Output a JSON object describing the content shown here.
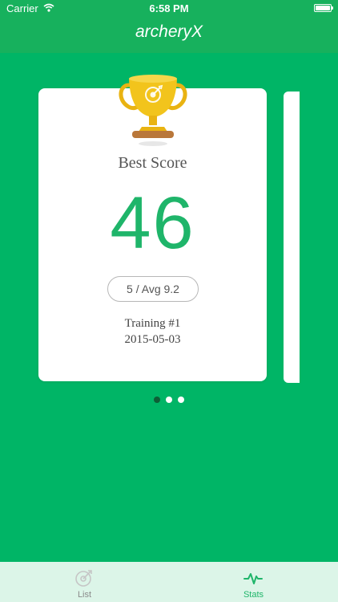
{
  "status": {
    "carrier": "Carrier",
    "time": "6:58 PM"
  },
  "nav": {
    "title": "archeryX"
  },
  "card": {
    "label": "Best Score",
    "score": "46",
    "pill": "5 / Avg 9.2",
    "session": "Training #1",
    "date": "2015-05-03"
  },
  "pager": {
    "current": 1,
    "total": 3
  },
  "tabs": [
    {
      "label": "List",
      "icon": "target-icon",
      "active": false
    },
    {
      "label": "Stats",
      "icon": "pulse-icon",
      "active": true
    }
  ],
  "colors": {
    "background": "#00b566",
    "topbar": "#17b15d",
    "accent": "#1fb56a",
    "tabbar": "#dcf5e8",
    "tab_inactive": "#8a8a8a",
    "tab_active": "#1fb56a"
  }
}
